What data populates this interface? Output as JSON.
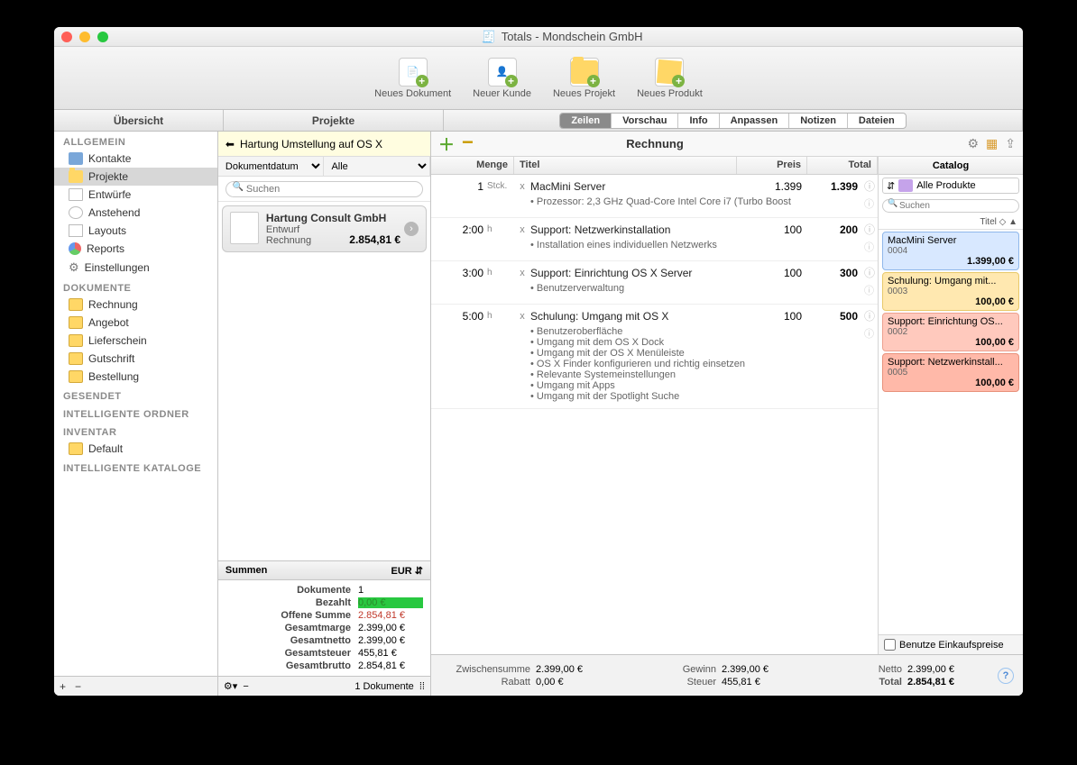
{
  "window_title": "Totals - Mondschein GmbH",
  "toolbar": [
    {
      "label": "Neues Dokument"
    },
    {
      "label": "Neuer Kunde"
    },
    {
      "label": "Neues Projekt"
    },
    {
      "label": "Neues Produkt"
    }
  ],
  "columns": {
    "sidebar": "Übersicht",
    "projects": "Projekte"
  },
  "segments": [
    "Zeilen",
    "Vorschau",
    "Info",
    "Anpassen",
    "Notizen",
    "Dateien"
  ],
  "sidebar": {
    "allgemein": {
      "title": "ALLGEMEIN",
      "items": [
        "Kontakte",
        "Projekte",
        "Entwürfe",
        "Anstehend",
        "Layouts",
        "Reports",
        "Einstellungen"
      ]
    },
    "dokumente": {
      "title": "DOKUMENTE",
      "items": [
        "Rechnung",
        "Angebot",
        "Lieferschein",
        "Gutschrift",
        "Bestellung"
      ]
    },
    "gesendet": "GESENDET",
    "intordner": "INTELLIGENTE ORDNER",
    "inventar": {
      "title": "INVENTAR",
      "items": [
        "Default"
      ]
    },
    "intkat": "INTELLIGENTE KATALOGE"
  },
  "projects": {
    "back": "Hartung Umstellung auf OS X",
    "filter1": "Dokumentdatum",
    "filter2": "Alle",
    "search_ph": "Suchen",
    "card": {
      "name": "Hartung Consult GmbH",
      "status": "Entwurf",
      "type": "Rechnung",
      "amount": "2.854,81 €"
    },
    "sum_title": "Summen",
    "sum_cur": "EUR",
    "sums": [
      {
        "lbl": "Dokumente",
        "val": "1"
      },
      {
        "lbl": "Bezahlt",
        "val": "0,00 €",
        "cls": "green"
      },
      {
        "lbl": "Offene Summe",
        "val": "2.854,81 €",
        "cls": "redv"
      },
      {
        "lbl": "Gesamtmarge",
        "val": "2.399,00 €"
      },
      {
        "lbl": "Gesamtnetto",
        "val": "2.399,00 €"
      },
      {
        "lbl": "Gesamtsteuer",
        "val": "455,81 €"
      },
      {
        "lbl": "Gesamtbrutto",
        "val": "2.854,81 €"
      }
    ],
    "footer_count": "1 Dokumente"
  },
  "invoice": {
    "title": "Rechnung",
    "head": {
      "menge": "Menge",
      "titel": "Titel",
      "preis": "Preis",
      "total": "Total"
    },
    "lines": [
      {
        "qty": "1",
        "unit": "Stck.",
        "title": "MacMini Server",
        "preis": "1.399",
        "total": "1.399",
        "desc": [
          "Prozessor: 2,3 GHz Quad-Core Intel Core i7 (Turbo Boost"
        ]
      },
      {
        "qty": "2:00",
        "unit": "h",
        "title": "Support: Netzwerkinstallation",
        "preis": "100",
        "total": "200",
        "desc": [
          "Installation eines individuellen Netzwerks"
        ]
      },
      {
        "qty": "3:00",
        "unit": "h",
        "title": "Support: Einrichtung OS X Server",
        "preis": "100",
        "total": "300",
        "desc": [
          "Benutzerverwaltung"
        ]
      },
      {
        "qty": "5:00",
        "unit": "h",
        "title": "Schulung: Umgang mit OS X",
        "preis": "100",
        "total": "500",
        "desc": [
          "Benutzeroberfläche",
          "Umgang mit dem OS X Dock",
          "Umgang mit der OS X Menüleiste",
          "OS X Finder konfigurieren und richtig einsetzen",
          "Relevante Systemeinstellungen",
          "Umgang mit Apps",
          "Umgang mit der Spotlight Suche"
        ]
      }
    ]
  },
  "catalog": {
    "title": "Catalog",
    "all": "Alle Produkte",
    "search_ph": "Suchen",
    "sort": "Titel ◇ ▲",
    "items": [
      {
        "t": "MacMini Server",
        "id": "0004",
        "pr": "1.399,00 €",
        "cls": "cat-blue"
      },
      {
        "t": "Schulung: Umgang mit...",
        "id": "0003",
        "pr": "100,00 €",
        "cls": "cat-yellow"
      },
      {
        "t": "Support: Einrichtung OS...",
        "id": "0002",
        "pr": "100,00 €",
        "cls": "cat-red1"
      },
      {
        "t": "Support: Netzwerkinstall...",
        "id": "0005",
        "pr": "100,00 €",
        "cls": "cat-red2"
      }
    ],
    "foot": "Benutze Einkaufspreise"
  },
  "footer": {
    "zwischen": {
      "lbl": "Zwischensumme",
      "val": "2.399,00 €"
    },
    "rabatt": {
      "lbl": "Rabatt",
      "val": "0,00 €"
    },
    "gewinn": {
      "lbl": "Gewinn",
      "val": "2.399,00 €"
    },
    "steuer": {
      "lbl": "Steuer",
      "val": "455,81 €"
    },
    "netto": {
      "lbl": "Netto",
      "val": "2.399,00 €"
    },
    "total": {
      "lbl": "Total",
      "val": "2.854,81 €"
    }
  }
}
